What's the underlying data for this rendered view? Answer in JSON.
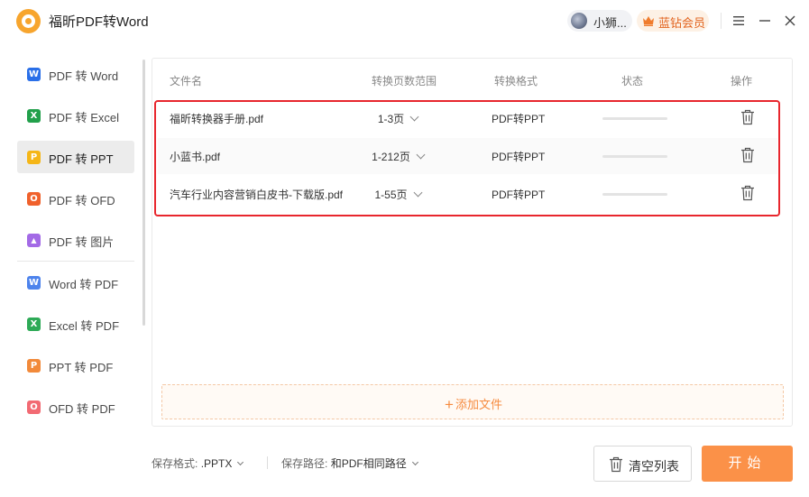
{
  "app": {
    "title": "福昕PDF转Word"
  },
  "titlebar": {
    "user_name": "小狮...",
    "vip_label": "蓝钻会员"
  },
  "sidebar": {
    "items": [
      {
        "label": "PDF 转 Word",
        "icon": "W",
        "color": "#2a6fe8",
        "active": false
      },
      {
        "label": "PDF 转 Excel",
        "icon": "X",
        "color": "#22a04b",
        "active": false
      },
      {
        "label": "PDF 转 PPT",
        "icon": "P",
        "color": "#f5b617",
        "active": true
      },
      {
        "label": "PDF 转 OFD",
        "icon": "O",
        "color": "#f0612c",
        "active": false
      },
      {
        "label": "PDF 转 图片",
        "icon": "▲",
        "color": "#a36ae6",
        "active": false
      },
      {
        "label": "Word 转 PDF",
        "icon": "W",
        "color": "#4d83ec",
        "active": false
      },
      {
        "label": "Excel 转 PDF",
        "icon": "X",
        "color": "#2eaa57",
        "active": false
      },
      {
        "label": "PPT 转 PDF",
        "icon": "P",
        "color": "#f28a3a",
        "active": false
      },
      {
        "label": "OFD 转 PDF",
        "icon": "O",
        "color": "#f26a73",
        "active": false
      }
    ]
  },
  "table": {
    "headers": {
      "name": "文件名",
      "range": "转换页数范围",
      "format": "转换格式",
      "status": "状态",
      "action": "操作"
    },
    "rows": [
      {
        "name": "福昕转换器手册.pdf",
        "range": "1-3页",
        "format": "PDF转PPT",
        "progress": 0
      },
      {
        "name": "小蓝书.pdf",
        "range": "1-212页",
        "format": "PDF转PPT",
        "progress": 0
      },
      {
        "name": "汽车行业内容营销白皮书-下载版.pdf",
        "range": "1-55页",
        "format": "PDF转PPT",
        "progress": 0
      }
    ]
  },
  "add_file": {
    "label": "添加文件"
  },
  "footer": {
    "format_label": "保存格式:",
    "format_value": ".PPTX",
    "path_label": "保存路径:",
    "path_value": "和PDF相同路径",
    "clear_label": "清空列表",
    "start_label": "开始"
  },
  "colors": {
    "accent": "#fb9148",
    "highlight": "#e8262d",
    "vip": "#e2641f"
  }
}
